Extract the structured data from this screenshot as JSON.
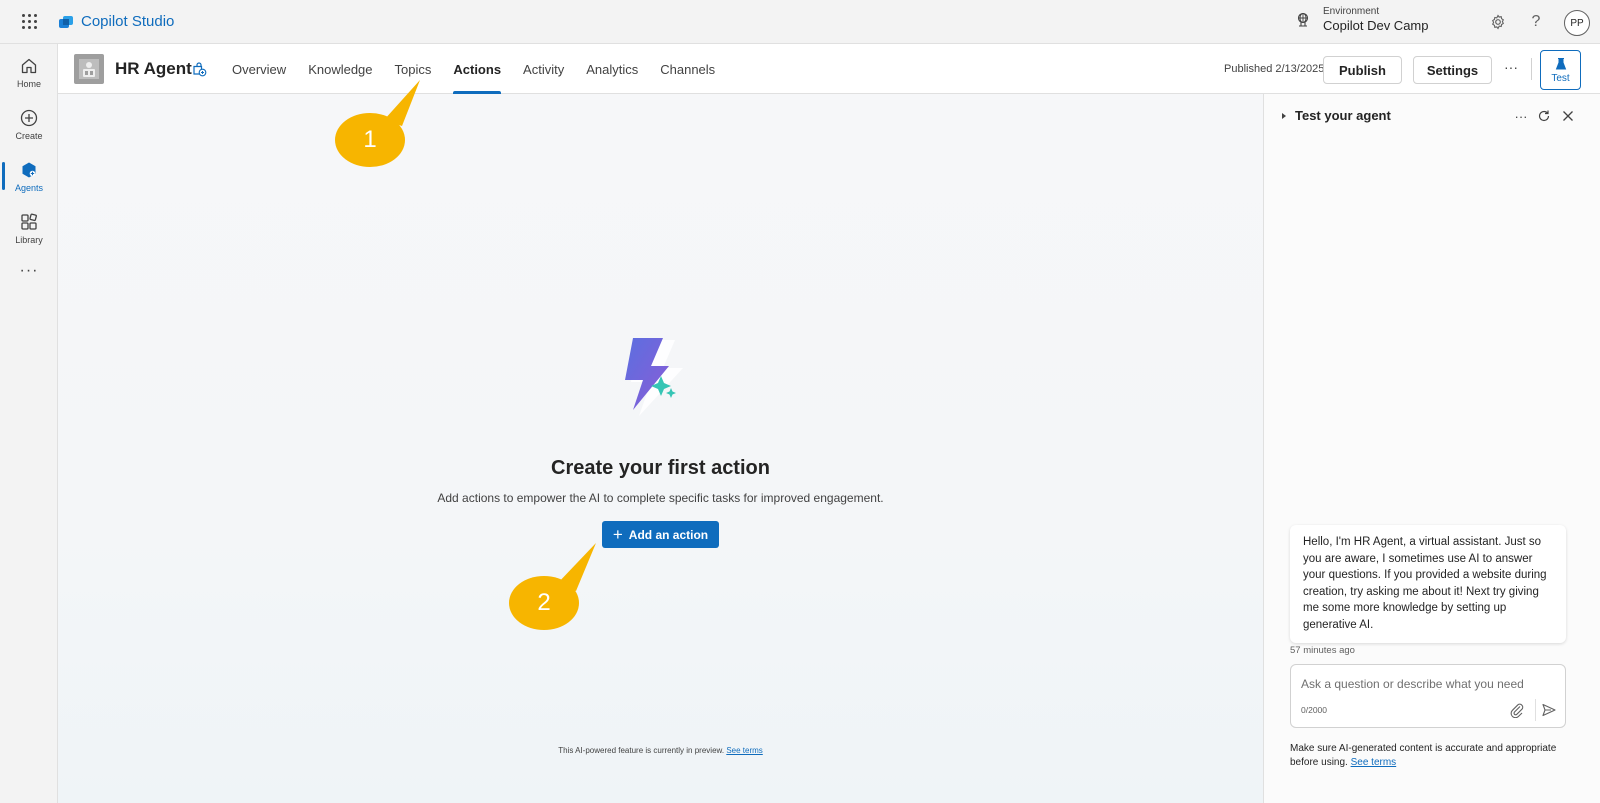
{
  "app": {
    "title": "Copilot Studio",
    "environment_label": "Environment",
    "environment_name": "Copilot Dev Camp",
    "user_initials": "PP",
    "brand_color": "#0f6cbd"
  },
  "rail": {
    "items": [
      {
        "label": "Home",
        "icon": "home-icon"
      },
      {
        "label": "Create",
        "icon": "plus-circle-icon"
      },
      {
        "label": "Agents",
        "icon": "agent-icon",
        "active": true
      },
      {
        "label": "Library",
        "icon": "library-icon"
      }
    ],
    "more": "···"
  },
  "header": {
    "agent_name": "HR Agent",
    "tabs": [
      {
        "label": "Overview"
      },
      {
        "label": "Knowledge"
      },
      {
        "label": "Topics"
      },
      {
        "label": "Actions",
        "active": true
      },
      {
        "label": "Activity"
      },
      {
        "label": "Analytics"
      },
      {
        "label": "Channels"
      }
    ],
    "published": "Published 2/13/2025",
    "publish_label": "Publish",
    "settings_label": "Settings",
    "more": "···",
    "test_label": "Test"
  },
  "empty_state": {
    "title": "Create your first action",
    "subtitle": "Add actions to empower the AI to complete specific tasks for improved engagement.",
    "add_button": "Add an action",
    "preview_note": "This AI-powered feature is currently in preview.",
    "see_terms": "See terms"
  },
  "callouts": [
    {
      "number": "1",
      "color": "#f7b500"
    },
    {
      "number": "2",
      "color": "#f7b500"
    }
  ],
  "test_panel": {
    "title": "Test your agent",
    "more": "···",
    "message": "Hello, I'm HR Agent, a virtual assistant. Just so you are aware, I sometimes use AI to answer your questions. If you provided a website during creation, try asking me about it! Next try giving me some more knowledge by setting up generative AI.",
    "timestamp": "57 minutes ago",
    "input_placeholder": "Ask a question or describe what you need",
    "char_count": "0/2000",
    "disclaimer": "Make sure AI-generated content is accurate and appropriate before using.",
    "see_terms": "See terms"
  }
}
